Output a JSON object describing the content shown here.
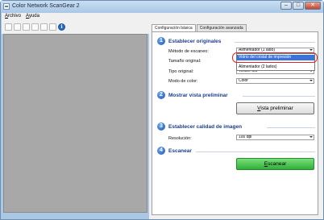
{
  "window": {
    "title": "Color Network ScanGear 2"
  },
  "menu": [
    {
      "prefix": "",
      "accel": "A",
      "rest": "rchivo"
    },
    {
      "prefix": "",
      "accel": "A",
      "rest": "yuda"
    }
  ],
  "tabs": [
    "Configuración básica",
    "Configuración avanzada"
  ],
  "sections": {
    "s1": {
      "num": "1",
      "title": "Establecer originales"
    },
    "s2": {
      "num": "2",
      "title": "Mostrar vista preliminar"
    },
    "s3": {
      "num": "3",
      "title": "Establecer calidad de imagen"
    },
    "s4": {
      "num": "4",
      "title": "Escanear"
    }
  },
  "fields": {
    "scan_method": {
      "label": "Método de escaneo:",
      "value": "Alimentador (1 lado)"
    },
    "original_size": {
      "label": "Tamaño original:"
    },
    "original_type": {
      "label": "Tipo original:",
      "value": "Texto/Foto"
    },
    "color_mode": {
      "label": "Modo de color:",
      "value": "Color"
    },
    "resolution": {
      "label": "Resolución:",
      "value": "100 dpi"
    }
  },
  "dropdown_options": [
    "Vidrio del cristal de impresión",
    "Alimentador (2 lados)"
  ],
  "buttons": {
    "preview": {
      "accel": "V",
      "rest": "ista preliminar"
    },
    "scan": {
      "accel": "E",
      "rest": "scanear"
    }
  },
  "colors": {
    "accent": "#1a3e8c",
    "scan_button": "#2fae3a",
    "highlight": "#e0242c",
    "selection": "#3b74d6"
  }
}
